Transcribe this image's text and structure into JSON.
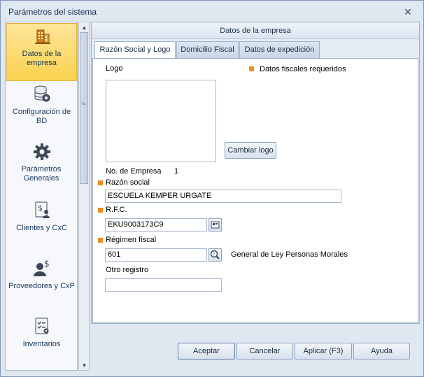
{
  "window": {
    "title": "Parámetros del sistema",
    "close_glyph": "✕"
  },
  "sidebar": {
    "items": [
      {
        "label": "Datos de la empresa",
        "icon": "building-icon",
        "active": true
      },
      {
        "label": "Configuración de BD",
        "icon": "database-gear-icon"
      },
      {
        "label": "Parámetros Generales",
        "icon": "gear-icon"
      },
      {
        "label": "Clientes y CxC",
        "icon": "clients-money-icon"
      },
      {
        "label": "Proveedores y CxP",
        "icon": "supplier-money-icon"
      },
      {
        "label": "Inventarios",
        "icon": "inventory-checklist-icon"
      }
    ]
  },
  "main": {
    "header": "Datos de la empresa",
    "tabs": [
      {
        "label": "Razón Social y Logo",
        "active": true
      },
      {
        "label": "Domicilio Fiscal"
      },
      {
        "label": "Datos de expedición"
      }
    ]
  },
  "form": {
    "logo_label": "Logo",
    "required_legend": "Datos fiscales requeridos",
    "change_logo_button": "Cambiar logo",
    "empresa_no_label": "No. de Empresa",
    "empresa_no_value": "1",
    "razon_social_label": "Razón social",
    "razon_social_value": "ESCUELA KEMPER URGATE",
    "rfc_label": "R.F.C.",
    "rfc_value": "EKU9003173C9",
    "regimen_label": "Régimen fiscal",
    "regimen_value": "601",
    "regimen_desc": "General de Ley Personas Morales",
    "otro_registro_label": "Otro registro",
    "otro_registro_value": ""
  },
  "footer": {
    "accept": "Aceptar",
    "cancel": "Cancelar",
    "apply": "Aplicar (F3)",
    "help": "Ayuda"
  },
  "colors": {
    "required": "#f08c19",
    "active_item": "#fbd14f",
    "accent": "#17375e"
  }
}
